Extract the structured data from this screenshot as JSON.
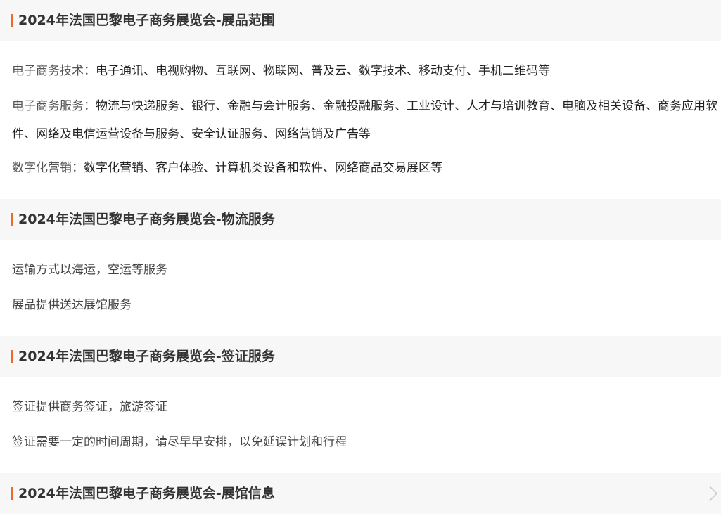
{
  "sections": [
    {
      "title": "2024年法国巴黎电子商务展览会-展品范围",
      "items": [
        {
          "key": "电子商务技术：",
          "value": "电子通讯、电视购物、互联网、物联网、普及云、数字技术、移动支付、手机二维码等"
        },
        {
          "key": "电子商务服务：",
          "value": "物流与快递服务、银行、金融与会计服务、金融投融服务、工业设计、人才与培训教育、电脑及相关设备、商务应用软件、网络及电信运营设备与服务、安全认证服务、网络营销及广告等"
        },
        {
          "key": "数字化营销：",
          "value": "数字化营销、客户体验、计算机类设备和软件、网络商品交易展区等"
        }
      ]
    },
    {
      "title": "2024年法国巴黎电子商务展览会-物流服务",
      "items": [
        {
          "text": "运输方式以海运，空运等服务"
        },
        {
          "text": "展品提供送达展馆服务"
        }
      ]
    },
    {
      "title": "2024年法国巴黎电子商务展览会-签证服务",
      "items": [
        {
          "text": "签证提供商务签证，旅游签证"
        },
        {
          "text": "签证需要一定的时间周期，请尽早早安排，以免延误计划和行程"
        }
      ]
    },
    {
      "title": "2024年法国巴黎电子商务展览会-展馆信息",
      "icon": "chevron-right-icon"
    }
  ],
  "colors": {
    "accent": "#ec6b22",
    "header_bg": "#f7f7f7"
  }
}
